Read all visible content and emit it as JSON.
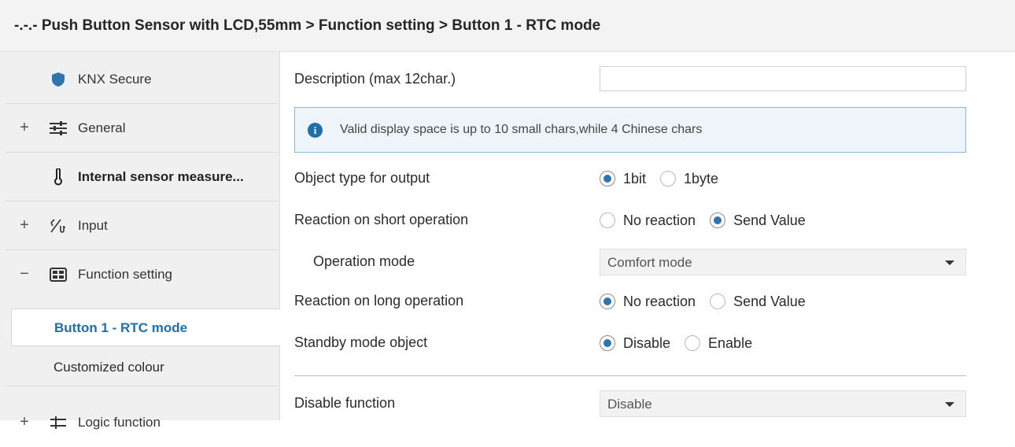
{
  "window": {
    "title": "-.-.- Push Button Sensor with LCD,55mm > Function setting > Button 1 - RTC mode"
  },
  "sidebar": {
    "items": [
      {
        "expander": "",
        "icon": "shield-icon",
        "label": "KNX Secure",
        "bold": false
      },
      {
        "expander": "+",
        "icon": "sliders-icon",
        "label": "General",
        "bold": false
      },
      {
        "expander": "",
        "icon": "thermometer-icon",
        "label": "Internal sensor measure...",
        "bold": true
      },
      {
        "expander": "+",
        "icon": "input-icon",
        "label": "Input",
        "bold": false
      },
      {
        "expander": "−",
        "icon": "grid-icon",
        "label": "Function setting",
        "bold": false
      }
    ],
    "subitems": [
      {
        "label": "Button 1 - RTC mode",
        "active": true
      },
      {
        "label": "Customized colour",
        "active": false
      }
    ],
    "last_item": {
      "expander": "+",
      "icon": "logic-icon",
      "label": "Logic function"
    }
  },
  "form": {
    "description_label": "Description (max 12char.)",
    "description_value": "",
    "info_text": "Valid display space is up to 10 small chars,while 4 Chinese chars",
    "object_type": {
      "label": "Object type for output",
      "options": [
        "1bit",
        "1byte"
      ],
      "selected": "1bit"
    },
    "short_op": {
      "label": "Reaction on short operation",
      "options": [
        "No reaction",
        "Send Value"
      ],
      "selected": "Send Value"
    },
    "operation_mode": {
      "label": "Operation mode",
      "value": "Comfort mode"
    },
    "long_op": {
      "label": "Reaction on long operation",
      "options": [
        "No reaction",
        "Send Value"
      ],
      "selected": "No reaction"
    },
    "standby": {
      "label": "Standby mode object",
      "options": [
        "Disable",
        "Enable"
      ],
      "selected": "Disable"
    },
    "disable_function": {
      "label": "Disable function",
      "value": "Disable"
    }
  },
  "colors": {
    "accent": "#2f75ad",
    "active_text": "#1f6fa8",
    "shield": "#2f75ad"
  }
}
